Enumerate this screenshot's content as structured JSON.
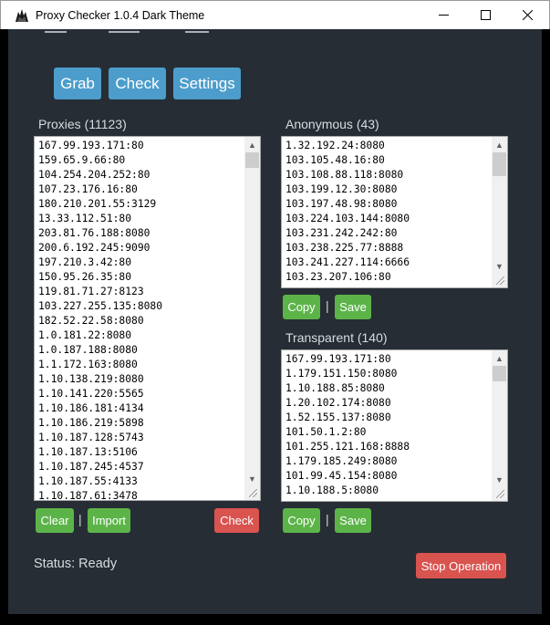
{
  "window": {
    "title": "Proxy Checker 1.0.4 Dark Theme",
    "minimize": "—",
    "maximize": "☐",
    "close": "✕"
  },
  "toolbar": {
    "grab_label": "Grab",
    "check_label": "Check",
    "settings_label": "Settings"
  },
  "proxies": {
    "label": "Proxies (11123)",
    "items": [
      "167.99.193.171:80",
      "159.65.9.66:80",
      "104.254.204.252:80",
      "107.23.176.16:80",
      "180.210.201.55:3129",
      "13.33.112.51:80",
      "203.81.76.188:8080",
      "200.6.192.245:9090",
      "197.210.3.42:80",
      "150.95.26.35:80",
      "119.81.71.27:8123",
      "103.227.255.135:8080",
      "182.52.22.58:8080",
      "1.0.181.22:8080",
      "1.0.187.188:8080",
      "1.1.172.163:8080",
      "1.10.138.219:8080",
      "1.10.141.220:5565",
      "1.10.186.181:4134",
      "1.10.186.219:5898",
      "1.10.187.128:5743",
      "1.10.187.13:5106",
      "1.10.187.245:4537",
      "1.10.187.55:4133",
      "1.10.187.61:3478"
    ],
    "clear_label": "Clear",
    "import_label": "Import",
    "check_label": "Check"
  },
  "anonymous": {
    "label": "Anonymous (43)",
    "items": [
      "1.32.192.24:8080",
      "103.105.48.16:80",
      "103.108.88.118:8080",
      "103.199.12.30:8080",
      "103.197.48.98:8080",
      "103.224.103.144:8080",
      "103.231.242.242:80",
      "103.238.225.77:8888",
      "103.241.227.114:6666",
      "103.23.207.106:80"
    ],
    "copy_label": "Copy",
    "save_label": "Save"
  },
  "transparent": {
    "label": "Transparent (140)",
    "items": [
      "167.99.193.171:80",
      "1.179.151.150:8080",
      "1.10.188.85:8080",
      "1.20.102.174:8080",
      "1.52.155.137:8080",
      "101.50.1.2:80",
      "101.255.121.168:8888",
      "1.179.185.249:8080",
      "101.99.45.154:8080",
      "1.10.188.5:8080"
    ],
    "copy_label": "Copy",
    "save_label": "Save"
  },
  "separator": "|",
  "status": {
    "text": "Status: Ready"
  },
  "stop_label": "Stop Operation",
  "colors": {
    "background": "#262d35",
    "accent_blue": "#4c9dcb",
    "success_green": "#5cb449",
    "danger_red": "#d9534f"
  }
}
